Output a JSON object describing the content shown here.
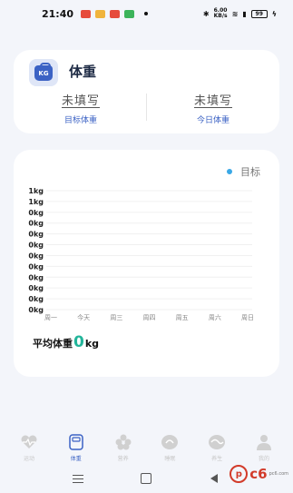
{
  "status_bar": {
    "time": "21:40",
    "speed": "6.00\nKB/s",
    "battery": "99"
  },
  "weight_card": {
    "title": "体重",
    "icon_text": "KG",
    "target": {
      "value": "未填写",
      "label": "目标体重"
    },
    "today": {
      "value": "未填写",
      "label": "今日体重"
    }
  },
  "chart_card": {
    "legend": "目标",
    "average_label": "平均体重",
    "average_value": "0",
    "average_unit": "kg"
  },
  "chart_data": {
    "type": "line",
    "categories": [
      "周一",
      "今天",
      "周三",
      "周四",
      "周五",
      "周六",
      "周日"
    ],
    "y_tick_labels": [
      "1kg",
      "1kg",
      "0kg",
      "0kg",
      "0kg",
      "0kg",
      "0kg",
      "0kg",
      "0kg",
      "0kg",
      "0kg",
      "0kg"
    ],
    "series": [],
    "colors": {
      "target": "#3aa8e6",
      "grid": "#f0f0f0"
    }
  },
  "tabs": [
    {
      "label": "运动",
      "icon": "heart-pulse-icon",
      "active": false
    },
    {
      "label": "体重",
      "icon": "scale-icon",
      "active": true
    },
    {
      "label": "营养",
      "icon": "flower-icon",
      "active": false
    },
    {
      "label": "睡眠",
      "icon": "moon-icon",
      "active": false
    },
    {
      "label": "养生",
      "icon": "yin-yang-icon",
      "active": false
    },
    {
      "label": "我的",
      "icon": "person-icon",
      "active": false
    }
  ],
  "watermark": {
    "text": "c6",
    "sub": "pc6.com"
  },
  "colors": {
    "accent": "#3b62c4",
    "average": "#22b59a"
  }
}
